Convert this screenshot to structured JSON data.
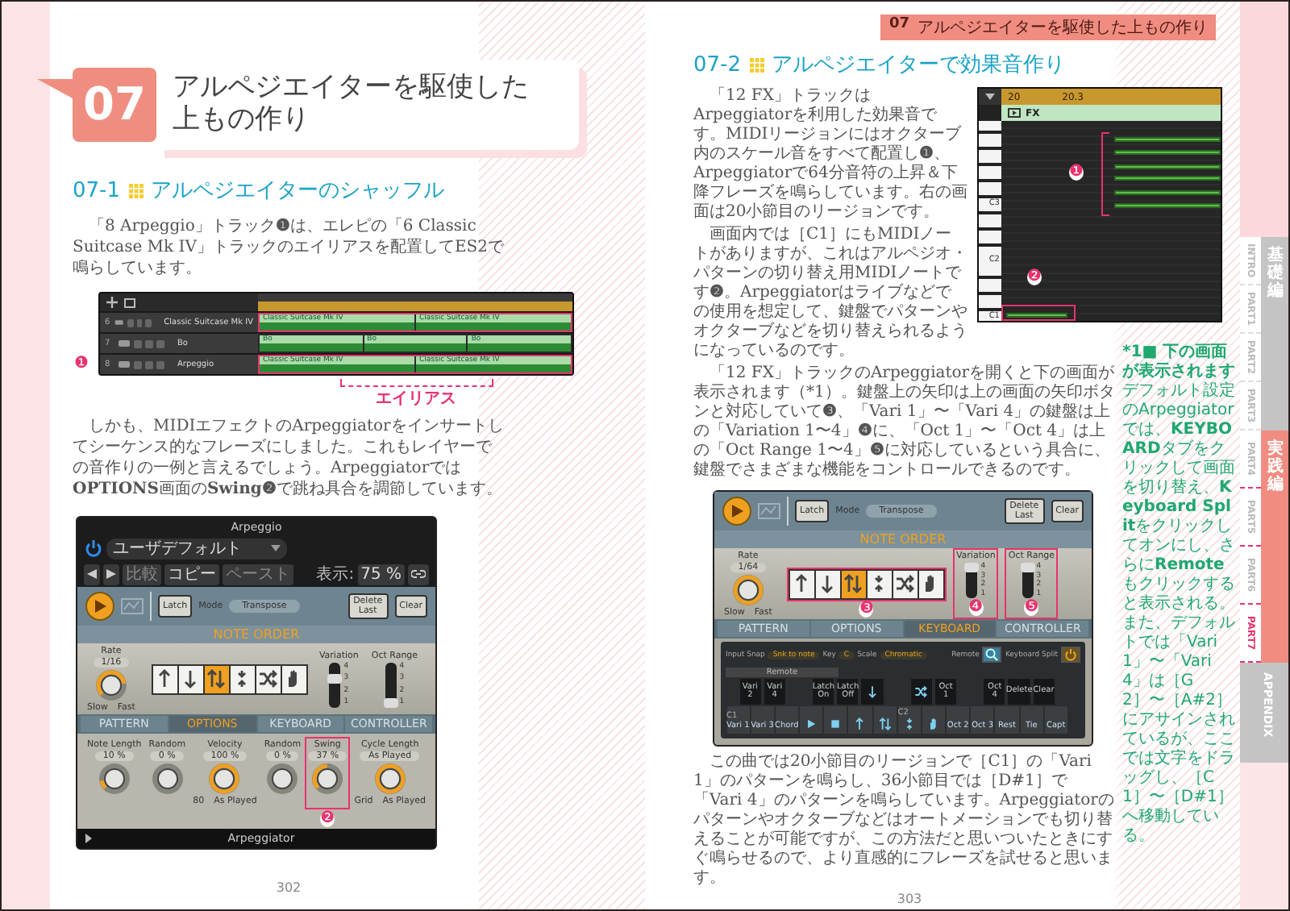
{
  "left_page": {
    "chapter_number": "07",
    "chapter_title": [
      "アルペジエイターを駆使した",
      "上もの作り"
    ],
    "section": {
      "number": "07-1",
      "title": "アルペジエイターのシャッフル"
    },
    "paragraph_1": "「8 Arpeggio」トラック**❶**は、エレピの「6 Classic Suitcase Mk IV」トラックのエイリアスを配置してES2で鳴らしています。",
    "tracks_window": {
      "tracks": [
        {
          "number": "6",
          "name": "Classic Suitcase Mk IV",
          "highlighted": true,
          "regions": [
            "Classic Suitcase Mk IV",
            "Classic Suitcase Mk IV"
          ]
        },
        {
          "number": "7",
          "name": "Bo",
          "highlighted": false,
          "regions": [
            "Bo",
            "Bo",
            "Bo"
          ]
        },
        {
          "number": "8",
          "name": "Arpeggio",
          "highlighted": true,
          "regions": [
            "Classic Suitcase Mk IV",
            "Classic Suitcase Mk IV"
          ]
        }
      ],
      "callout": "❶",
      "alias_label": "エイリアス"
    },
    "paragraph_2": "しかも、MIDIエフェクトのArpeggiatorをインサートしてシーケンス的なフレーズにしました。これもレイヤーでの音作りの一例と言えるでしょう。Arpeggiatorでは**OPTIONS**画面の**Swing❷**で跳ね具合を調節しています。",
    "plugin": {
      "title": "Arpeggio",
      "preset": "ユーザデフォルト",
      "compare": "比較",
      "copy": "コピー",
      "paste": "ペースト",
      "view_label": "表示:",
      "zoom": "75 %",
      "latch": "Latch",
      "mode_label": "Mode",
      "mode": "Transpose",
      "delete_last": "Delete Last",
      "clear": "Clear",
      "note_order": "NOTE ORDER",
      "rate_label": "Rate",
      "rate": "1/16",
      "rate_knob": {
        "level": 0.6
      },
      "slow": "Slow",
      "fast": "Fast",
      "order_buttons": [
        {
          "kind": "up",
          "selected": false
        },
        {
          "kind": "down",
          "selected": false
        },
        {
          "kind": "updown",
          "selected": true
        },
        {
          "kind": "outin",
          "selected": false
        },
        {
          "kind": "random",
          "selected": false
        },
        {
          "kind": "manual",
          "selected": false
        }
      ],
      "sliders": [
        {
          "label": "Variation",
          "scale": [
            "4",
            "3",
            "2",
            "1"
          ],
          "level": 0.67
        },
        {
          "label": "Oct Range",
          "scale": [
            "4",
            "3",
            "2",
            "1"
          ],
          "level": 0
        }
      ],
      "tabs": [
        {
          "label": "PATTERN",
          "selected": false
        },
        {
          "label": "OPTIONS",
          "selected": true
        },
        {
          "label": "KEYBOARD",
          "selected": false
        },
        {
          "label": "CONTROLLER",
          "selected": false
        }
      ],
      "knobs": [
        {
          "label": "Note Length",
          "value": "10 %",
          "level": 0.1
        },
        {
          "label": "Random",
          "value": "0 %",
          "level": 0
        },
        {
          "label": "Velocity",
          "value": "100 %",
          "level": 1,
          "range": [
            "80",
            "As Played"
          ]
        },
        {
          "label": "Random",
          "value": "0 %",
          "level": 0
        },
        {
          "label": "Swing",
          "value": "37 %",
          "level": 0.37,
          "callout": "❷"
        },
        {
          "label": "Cycle Length",
          "value": "As Played",
          "level": 1,
          "range": [
            "Grid",
            "As Played"
          ]
        }
      ],
      "footer": "Arpeggiator"
    },
    "page_number": "302"
  },
  "right_page": {
    "running_head": {
      "number": "07",
      "title": "アルペジエイターを駆使した上もの作り"
    },
    "section": {
      "number": "07-2",
      "title": "アルペジエイターで効果音作り"
    },
    "piano_roll": {
      "ruler": [
        "20",
        "20.3"
      ],
      "region": "FX",
      "pitch_labels": [
        "C3",
        "C2",
        "C1"
      ],
      "callouts": [
        "❶",
        "❷"
      ]
    },
    "paragraphs": [
      "「12 FX」トラックはArpeggiatorを利用した効果音です。MIDIリージョンにはオクターブ内のスケール音をすべて配置し**❶**、Arpeggiatorで64分音符の上昇＆下降フレーズを鳴らしています。右の画面は20小節目のリージョンです。",
      "画面内では［C1］にもMIDIノートがありますが、これはアルペジオ・パターンの切り替え用MIDIノートです**❷**。Arpeggiatorはライブなどでの使用を想定して、鍵盤でパターンやオクターブなどを切り替えられるようになっているのです。",
      "「12 FX」トラックのArpeggiatorを開くと下の画面が表示されます（*1）。鍵盤上の矢印は上の画面の矢印ボタンと対応していて**❸**、「Vari 1」〜「Vari 4」の鍵盤は上の「Variation 1〜4」**❹**に、「Oct 1」〜「Oct 4」は上の「Oct Range 1〜4」**❺**に対応しているという具合に、鍵盤でさまざまな機能をコントロールできるのです。"
    ],
    "plugin": {
      "latch": "Latch",
      "mode_label": "Mode",
      "mode": "Transpose",
      "delete_last": "Delete Last",
      "clear": "Clear",
      "note_order": "NOTE ORDER",
      "rate_label": "Rate",
      "rate": "1/64",
      "rate_knob": {
        "level": 1
      },
      "slow": "Slow",
      "fast": "Fast",
      "order_buttons": [
        {
          "kind": "up",
          "selected": false
        },
        {
          "kind": "down",
          "selected": false
        },
        {
          "kind": "updown",
          "selected": true
        },
        {
          "kind": "outin",
          "selected": false
        },
        {
          "kind": "random",
          "selected": false
        },
        {
          "kind": "manual",
          "selected": false
        }
      ],
      "order_callout": "❸",
      "sliders": [
        {
          "label": "Variation",
          "scale": [
            "4",
            "3",
            "2",
            "1"
          ],
          "level": 1,
          "callout": "❹"
        },
        {
          "label": "Oct Range",
          "scale": [
            "4",
            "3",
            "2",
            "1"
          ],
          "level": 1,
          "callout": "❺"
        }
      ],
      "tabs": [
        {
          "label": "PATTERN",
          "selected": false
        },
        {
          "label": "OPTIONS",
          "selected": false
        },
        {
          "label": "KEYBOARD",
          "selected": true
        },
        {
          "label": "CONTROLLER",
          "selected": false
        }
      ],
      "keyboard": {
        "input_snap_label": "Input Snap",
        "input_snap": "Snk to note",
        "key_label": "Key",
        "key": "C",
        "scale_label": "Scale",
        "scale": "Chromatic",
        "remote_label": "Remote",
        "remote_on": true,
        "split_label": "Keyboard Split",
        "split_on": true,
        "remote_bar": "Remote",
        "white_keys": [
          {
            "label": "Vari 1",
            "note": "C1",
            "black_key": {
              "label": "Vari 2"
            }
          },
          {
            "label": "Vari 3",
            "black_key": {
              "label": "Vari 4"
            }
          },
          {
            "label": "Chord"
          },
          {
            "kind": "play",
            "black_key": {
              "label": "Latch On"
            }
          },
          {
            "kind": "stop",
            "black_key": {
              "label": "Latch Off"
            }
          },
          {
            "kind": "up",
            "black_key": {
              "kind": "down"
            }
          },
          {
            "kind": "updown"
          },
          {
            "kind": "outin",
            "note": "C2",
            "black_key": {
              "kind": "random"
            }
          },
          {
            "kind": "manual",
            "black_key": {
              "label": "Oct 1"
            }
          },
          {
            "label": "Oct 2"
          },
          {
            "label": "Oct 3",
            "black_key": {
              "label": "Oct 4"
            }
          },
          {
            "label": "Rest",
            "black_key": {
              "label": "Delete"
            }
          },
          {
            "label": "Tie",
            "black_key": {
              "label": "Clear"
            }
          },
          {
            "label": "Capt"
          }
        ]
      }
    },
    "paragraph_4": "この曲では20小節目のリージョンで［C1］の「Vari 1」のパターンを鳴らし、36小節目では［D#1］で「Vari 4」のパターンを鳴らしています。Arpeggiatorのパターンやオクターブなどはオートメーションでも切り替えることが可能ですが、この方法だと思いついたときにすぐ鳴らせるので、より直感的にフレーズを試せると思います。",
    "page_number": "303",
    "side_note": {
      "title": "*1■ 下の画面が表示されます",
      "text": "デフォルト設定のArpeggiatorでは、**KEYBOARD**タブをクリックして画面を切り替え、**Keyboard Split**をクリックしてオンにし、さらに**Remote**もクリックすると表示される。また、デフォルトでは「Vari 1」〜「Vari 4」は［G2］〜［A#2］にアサインされているが、ここでは文字をドラッグし、［C1］〜［D#1］へ移動している。"
    },
    "index_tabs": [
      {
        "kind": "group",
        "label": "基礎編",
        "selected": false,
        "parts": [
          {
            "label": "INTRO",
            "selected": false
          },
          {
            "label": "PART1",
            "selected": false
          },
          {
            "label": "PART2",
            "selected": false
          },
          {
            "label": "PART3",
            "selected": false
          }
        ]
      },
      {
        "kind": "group",
        "label": "実践編",
        "selected": true,
        "parts": [
          {
            "label": "PART4",
            "selected": false
          },
          {
            "label": "PART5",
            "selected": false
          },
          {
            "label": "PART6",
            "selected": false
          },
          {
            "label": "PART7",
            "selected": true
          }
        ]
      },
      {
        "kind": "tab",
        "label": "APPENDIX",
        "selected": false
      }
    ]
  }
}
